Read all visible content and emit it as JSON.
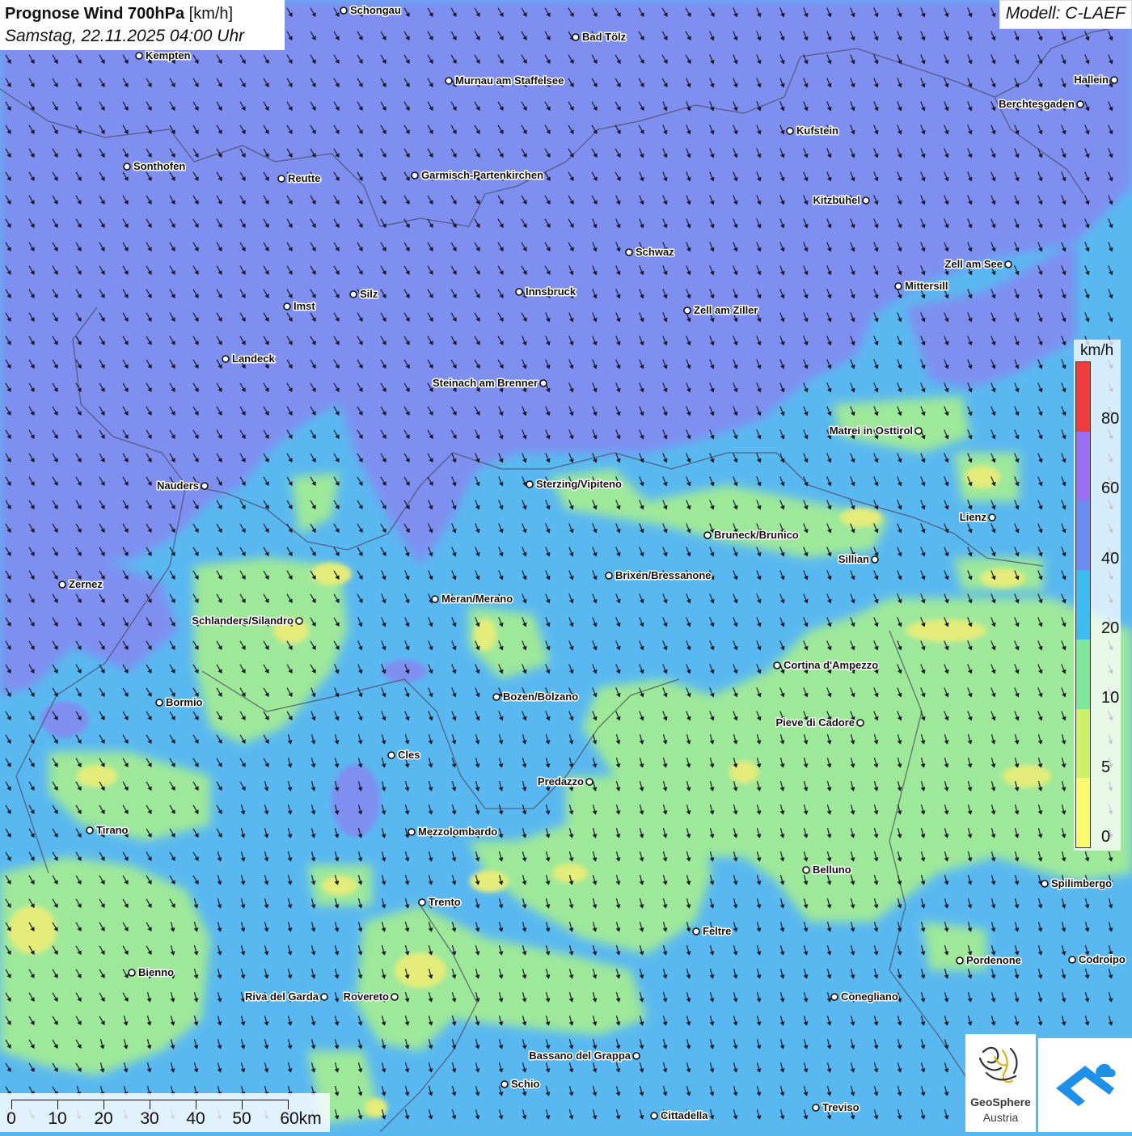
{
  "header": {
    "title_bold": "Prognose Wind 700hPa",
    "title_unit": "[km/h]",
    "subtitle": "Samstag, 22.11.2025 04:00 Uhr"
  },
  "model": "Modell: C-LAEF",
  "legend": {
    "unit": "km/h",
    "ticks": [
      "80",
      "60",
      "40",
      "20",
      "10",
      "5",
      "0"
    ],
    "colors": [
      "#f03c3c",
      "#9a6ef0",
      "#6a8ef0",
      "#3cbcf0",
      "#7de89a",
      "#cdf06a",
      "#fafa6e"
    ]
  },
  "scale_bar": {
    "labels": [
      "0",
      "10",
      "20",
      "30",
      "40",
      "50",
      "60km"
    ]
  },
  "logos": {
    "geosphere_line1": "GeoSphere",
    "geosphere_line2": "Austria"
  },
  "colors": {
    "violet": "#7e8ff0",
    "blue": "#5ab8f0",
    "green": "#9ee89a",
    "yellow": "#e4ec7a",
    "purple": "#8a6ee0"
  },
  "cities": [
    {
      "name": "Schongau",
      "side": "right"
    },
    {
      "name": "Bad Tölz",
      "side": "right"
    },
    {
      "name": "Kempten",
      "side": "right"
    },
    {
      "name": "Murnau am Staffelsee",
      "side": "right"
    },
    {
      "name": "Hallein",
      "side": "left"
    },
    {
      "name": "Berchtesgaden",
      "side": "left"
    },
    {
      "name": "Kufstein",
      "side": "right"
    },
    {
      "name": "Sonthofen",
      "side": "right"
    },
    {
      "name": "Reutte",
      "side": "right"
    },
    {
      "name": "Garmisch-Partenkirchen",
      "side": "right"
    },
    {
      "name": "Kitzbühel",
      "side": "left"
    },
    {
      "name": "Schwaz",
      "side": "right"
    },
    {
      "name": "Zell am See",
      "side": "left"
    },
    {
      "name": "Mittersill",
      "side": "right"
    },
    {
      "name": "Innsbruck",
      "side": "right"
    },
    {
      "name": "Imst",
      "side": "right"
    },
    {
      "name": "Silz",
      "side": "right"
    },
    {
      "name": "Zell am Ziller",
      "side": "right"
    },
    {
      "name": "Landeck",
      "side": "right"
    },
    {
      "name": "Steinach am Brenner",
      "side": "left"
    },
    {
      "name": "Matrei in Osttirol",
      "side": "left"
    },
    {
      "name": "Nauders",
      "side": "left"
    },
    {
      "name": "Sterzing/Vipiteno",
      "side": "right"
    },
    {
      "name": "Lienz",
      "side": "left"
    },
    {
      "name": "Bruneck/Brunico",
      "side": "right"
    },
    {
      "name": "Sillian",
      "side": "left"
    },
    {
      "name": "Brixen/Bressanone",
      "side": "right"
    },
    {
      "name": "Zernez",
      "side": "right"
    },
    {
      "name": "Meran/Merano",
      "side": "right"
    },
    {
      "name": "Schlanders/Silandro",
      "side": "left"
    },
    {
      "name": "Cortina d'Ampezzo",
      "side": "right"
    },
    {
      "name": "Bormio",
      "side": "right"
    },
    {
      "name": "Bozen/Bolzano",
      "side": "right"
    },
    {
      "name": "Pieve di Cadore",
      "side": "left"
    },
    {
      "name": "Cles",
      "side": "right"
    },
    {
      "name": "Predazzo",
      "side": "left"
    },
    {
      "name": "Tirano",
      "side": "right"
    },
    {
      "name": "Mezzolombardo",
      "side": "right"
    },
    {
      "name": "Belluno",
      "side": "right"
    },
    {
      "name": "Spilimbergo",
      "side": "right"
    },
    {
      "name": "Trento",
      "side": "right"
    },
    {
      "name": "Feltre",
      "side": "right"
    },
    {
      "name": "Pordenone",
      "side": "right"
    },
    {
      "name": "Codroipo",
      "side": "right"
    },
    {
      "name": "Bienno",
      "side": "right"
    },
    {
      "name": "Riva del Garda",
      "side": "left"
    },
    {
      "name": "Rovereto",
      "side": "left"
    },
    {
      "name": "Conegliano",
      "side": "right"
    },
    {
      "name": "Bassano del Grappa",
      "side": "left"
    },
    {
      "name": "Schio",
      "side": "right"
    },
    {
      "name": "Cittadella",
      "side": "right"
    },
    {
      "name": "Treviso",
      "side": "right"
    }
  ]
}
